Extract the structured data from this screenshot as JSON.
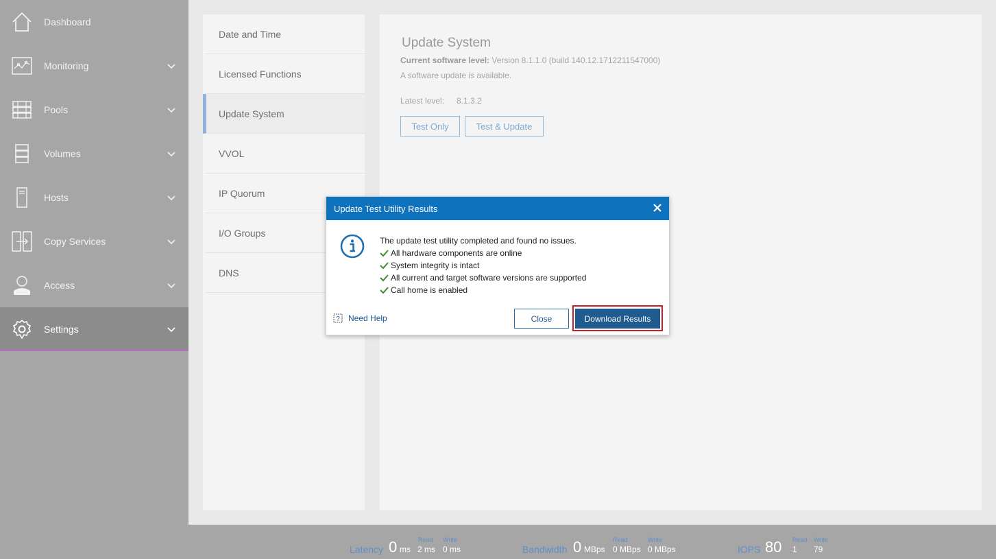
{
  "sidebar": {
    "items": [
      {
        "label": "Dashboard",
        "icon": "home-icon"
      },
      {
        "label": "Monitoring",
        "icon": "monitoring-icon"
      },
      {
        "label": "Pools",
        "icon": "pools-icon"
      },
      {
        "label": "Volumes",
        "icon": "volumes-icon"
      },
      {
        "label": "Hosts",
        "icon": "hosts-icon"
      },
      {
        "label": "Copy Services",
        "icon": "copy-services-icon"
      },
      {
        "label": "Access",
        "icon": "access-icon"
      },
      {
        "label": "Settings",
        "icon": "gear-icon"
      }
    ],
    "active": "Settings"
  },
  "settings_menu": {
    "items": [
      {
        "label": "Date and Time"
      },
      {
        "label": "Licensed Functions"
      },
      {
        "label": "Update System"
      },
      {
        "label": "VVOL"
      },
      {
        "label": "IP Quorum"
      },
      {
        "label": "I/O Groups"
      },
      {
        "label": "DNS"
      }
    ],
    "selected": "Update System"
  },
  "content": {
    "title": "Update System",
    "current_level_label": "Current software level:",
    "current_level_value": "Version 8.1.1.0 (build 140.12.1712211547000)",
    "update_available": "A software update is available.",
    "latest_level_label": "Latest level:",
    "latest_level_value": "8.1.3.2",
    "test_only_label": "Test Only",
    "test_update_label": "Test & Update"
  },
  "dialog": {
    "title": "Update Test Utility Results",
    "message": "The update test utility completed and found no issues.",
    "checks": [
      "All hardware components are online",
      "System integrity is intact",
      "All current and target software versions are supported",
      "Call home is enabled"
    ],
    "help_label": "Need Help",
    "close_label": "Close",
    "download_label": "Download Results"
  },
  "status_bar": {
    "latency": {
      "label": "Latency",
      "value": "0",
      "unit": "ms",
      "read_label": "Read",
      "read_value": "2 ms",
      "write_label": "Write",
      "write_value": "0 ms"
    },
    "bandwidth": {
      "label": "Bandwidth",
      "value": "0",
      "unit": "MBps",
      "read_label": "Read",
      "read_value": "0 MBps",
      "write_label": "Write",
      "write_value": "0 MBps"
    },
    "iops": {
      "label": "IOPS",
      "value": "80",
      "read_label": "Read",
      "read_value": "1",
      "write_label": "Write",
      "write_value": "79"
    }
  },
  "colors": {
    "sidebar_bg": "#a6a6a6",
    "dialog_header": "#0f72bd",
    "primary_button": "#1f5b8e",
    "highlight_border": "#c8202b",
    "check_green": "#3e8e2b",
    "active_underline": "#b56ec0"
  }
}
